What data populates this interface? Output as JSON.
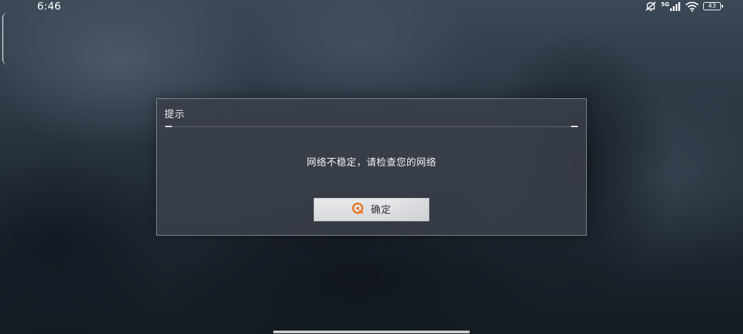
{
  "status_bar": {
    "time": "6:46",
    "network_label": "5G",
    "battery_level": "43",
    "icons": [
      "mute-icon",
      "signal-icon",
      "wifi-icon",
      "battery-icon"
    ]
  },
  "dialog": {
    "title": "提示",
    "message": "网络不稳定，请检查您的网络",
    "confirm_label": "确定",
    "confirm_icon": "circle-button-icon",
    "accent_color": "#e8731e"
  }
}
